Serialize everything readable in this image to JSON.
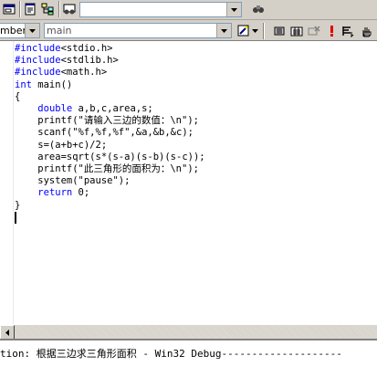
{
  "toolbar1": {
    "icons": [
      "windows-icon",
      "new-window-icon",
      "hierarchy-icon",
      "binoculars-icon",
      "find-in-files-icon"
    ],
    "find_combo_value": ""
  },
  "toolbar2": {
    "class_combo_value": "mbers",
    "function_combo_value": "main",
    "icons": [
      "wand-icon",
      "compile-icon",
      "build-icon",
      "stop-build-icon",
      "execute-icon",
      "breakpoint-icon",
      "hand-icon"
    ]
  },
  "editor": {
    "lines": [
      [
        {
          "t": "#include",
          "k": 1
        },
        {
          "t": "<stdio.h>"
        }
      ],
      [
        {
          "t": "#include",
          "k": 1
        },
        {
          "t": "<stdlib.h>"
        }
      ],
      [
        {
          "t": "#include",
          "k": 1
        },
        {
          "t": "<math.h>"
        }
      ],
      [
        {
          "t": "int",
          "k": 1
        },
        {
          "t": " main()"
        }
      ],
      [
        {
          "t": "{"
        }
      ],
      [
        {
          "t": "    "
        },
        {
          "t": "double",
          "k": 1
        },
        {
          "t": " a,b,c,area,s;"
        }
      ],
      [
        {
          "t": "    printf(\"请输入三边的数值：\\n\");"
        }
      ],
      [
        {
          "t": "    scanf(\"%f,%f,%f\",&a,&b,&c);"
        }
      ],
      [
        {
          "t": "    s=(a+b+c)/2;"
        }
      ],
      [
        {
          "t": "    area=sqrt(s*(s-a)(s-b)(s-c));"
        }
      ],
      [
        {
          "t": "    printf(\"此三角形的面积为：\\n\");"
        }
      ],
      [
        {
          "t": "    system(\"pause\");"
        }
      ],
      [
        {
          "t": "    "
        },
        {
          "t": "return",
          "k": 1
        },
        {
          "t": " 0;"
        }
      ],
      [
        {
          "t": "}"
        }
      ]
    ]
  },
  "output": {
    "text": "tion: 根据三边求三角形面积 - Win32 Debug--------------------"
  }
}
